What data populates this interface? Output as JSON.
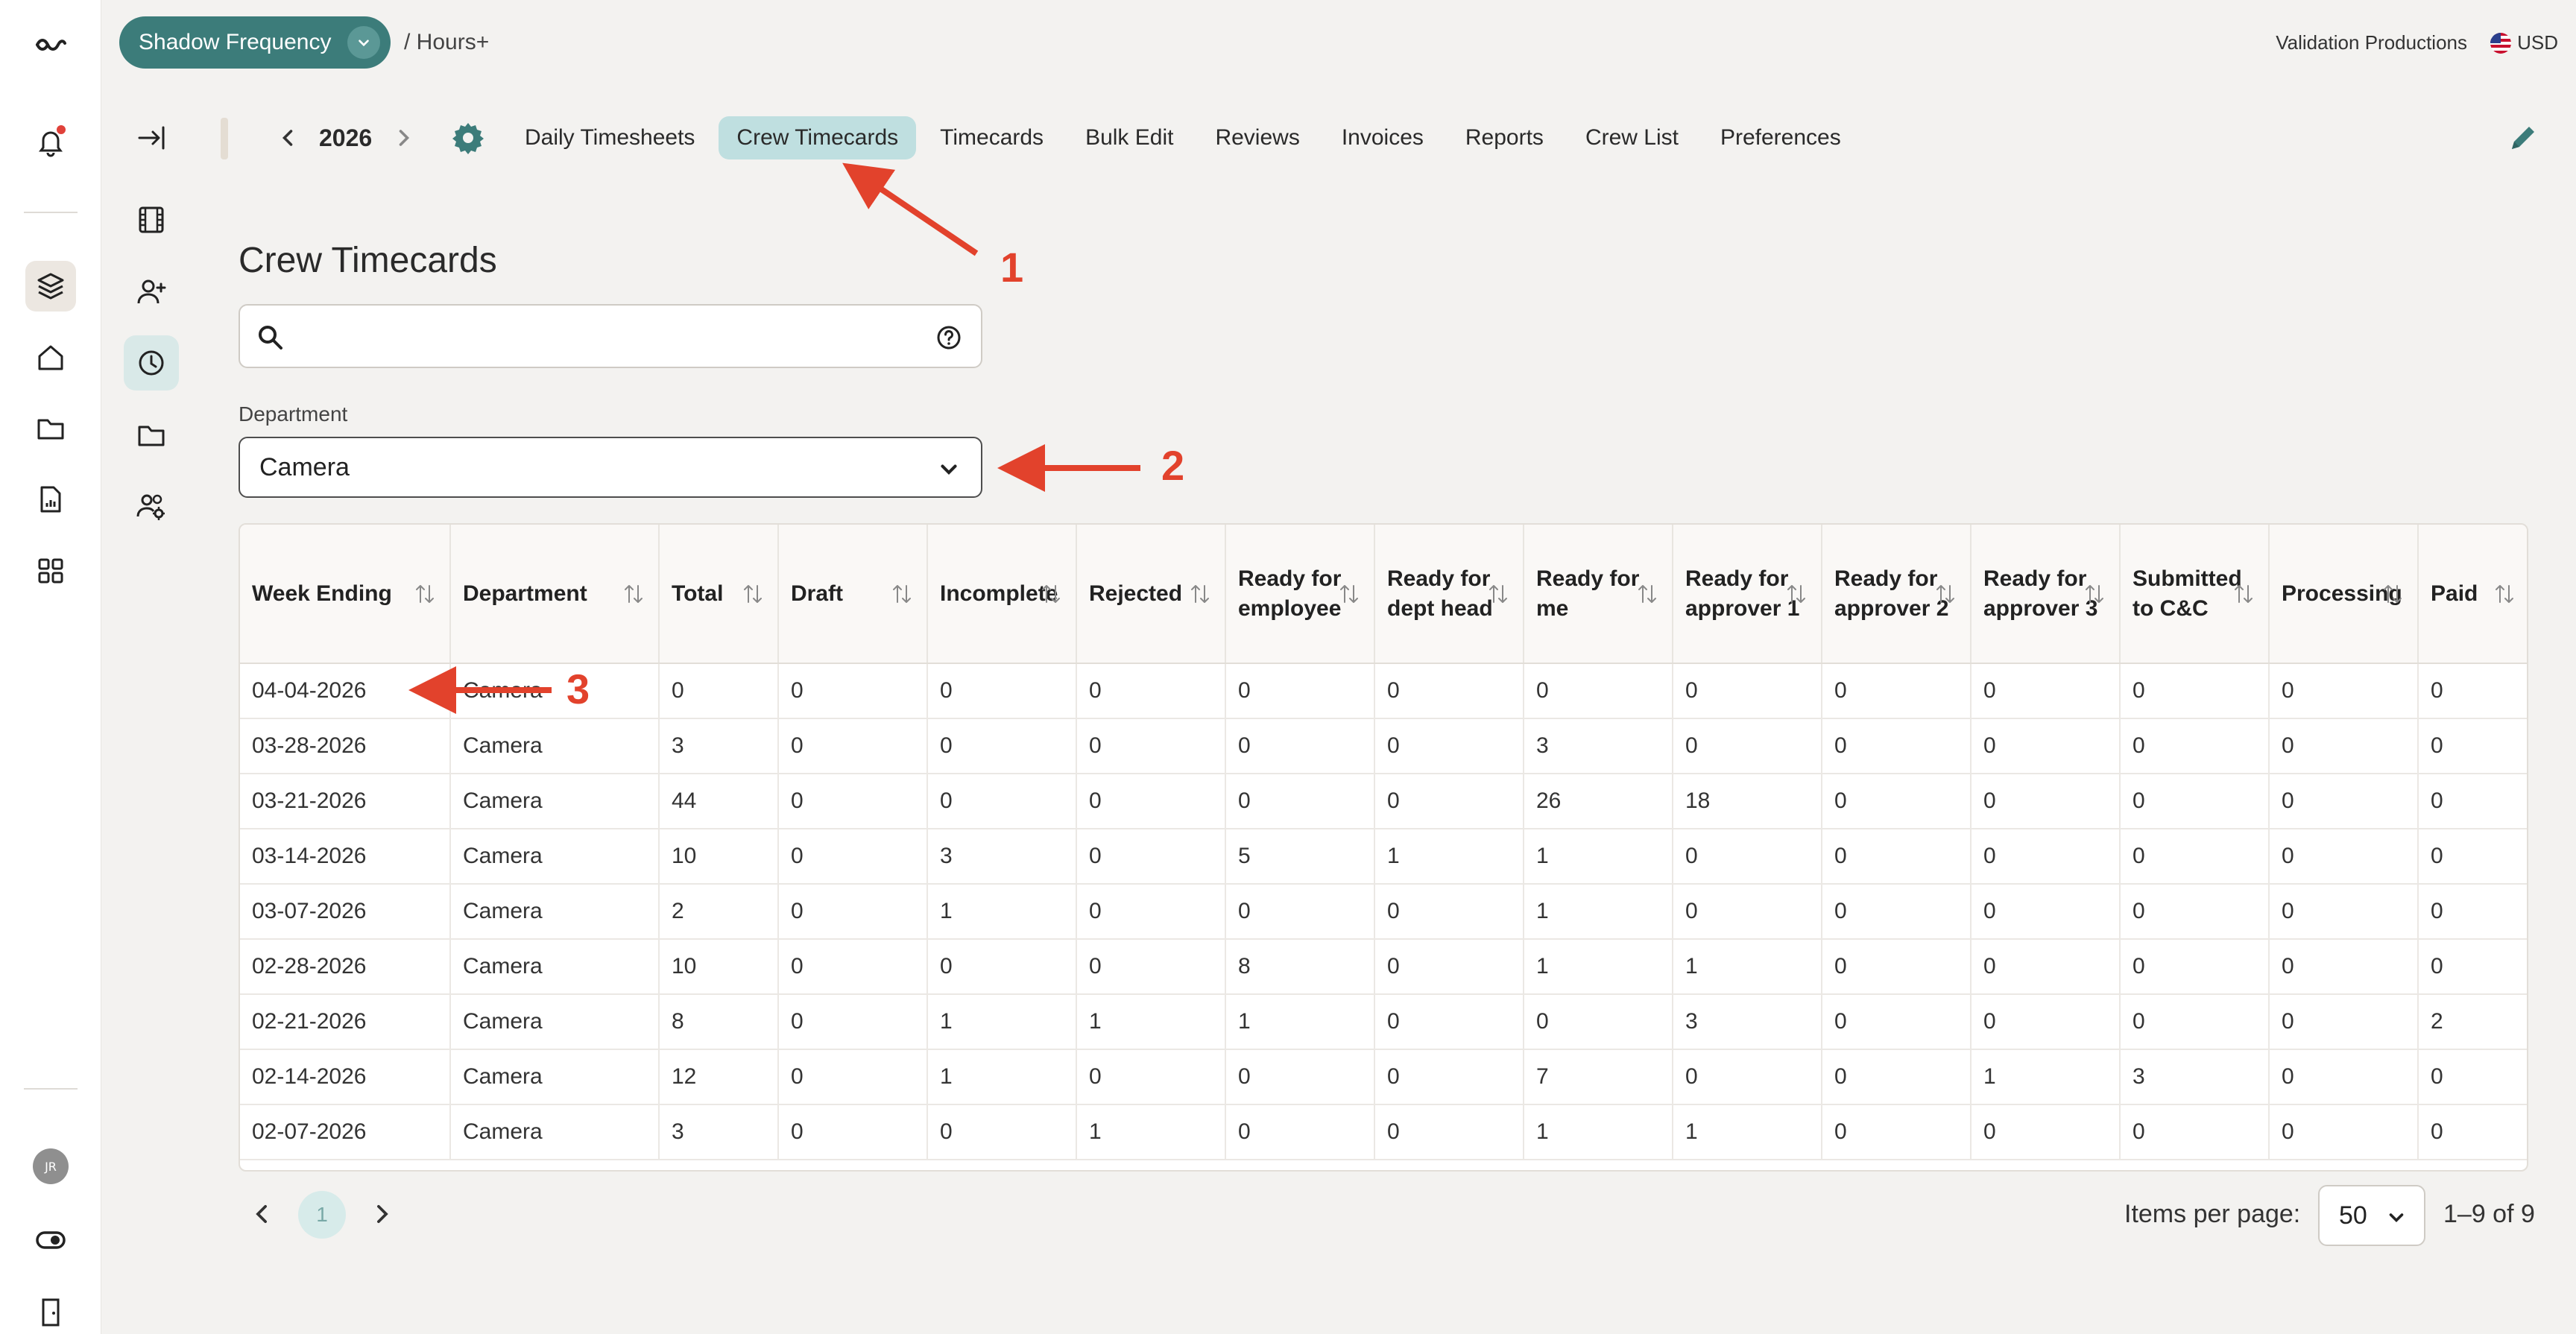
{
  "app": {
    "project_name": "Shadow Frequency",
    "breadcrumb": "/ Hours+",
    "company": "Validation Productions",
    "currency": "USD",
    "user_initials": "JR"
  },
  "nav": {
    "year": "2026",
    "tabs": [
      {
        "label": "Daily Timesheets"
      },
      {
        "label": "Crew Timecards",
        "active": true
      },
      {
        "label": "Timecards"
      },
      {
        "label": "Bulk Edit"
      },
      {
        "label": "Reviews"
      },
      {
        "label": "Invoices"
      },
      {
        "label": "Reports"
      },
      {
        "label": "Crew List"
      },
      {
        "label": "Preferences"
      }
    ]
  },
  "page": {
    "title": "Crew Timecards",
    "search": {
      "value": "",
      "placeholder": ""
    },
    "department_label": "Department",
    "department_value": "Camera"
  },
  "table": {
    "columns": [
      "Week Ending",
      "Department",
      "Total",
      "Draft",
      "Incomplete",
      "Rejected",
      "Ready for employee",
      "Ready for dept head",
      "Ready for me",
      "Ready for approver 1",
      "Ready for approver 2",
      "Ready for approver 3",
      "Submitted to C&C",
      "Processing",
      "Paid"
    ],
    "rows": [
      [
        "04-04-2026",
        "Camera",
        "0",
        "0",
        "0",
        "0",
        "0",
        "0",
        "0",
        "0",
        "0",
        "0",
        "0",
        "0",
        "0"
      ],
      [
        "03-28-2026",
        "Camera",
        "3",
        "0",
        "0",
        "0",
        "0",
        "0",
        "3",
        "0",
        "0",
        "0",
        "0",
        "0",
        "0"
      ],
      [
        "03-21-2026",
        "Camera",
        "44",
        "0",
        "0",
        "0",
        "0",
        "0",
        "26",
        "18",
        "0",
        "0",
        "0",
        "0",
        "0"
      ],
      [
        "03-14-2026",
        "Camera",
        "10",
        "0",
        "3",
        "0",
        "5",
        "1",
        "1",
        "0",
        "0",
        "0",
        "0",
        "0",
        "0"
      ],
      [
        "03-07-2026",
        "Camera",
        "2",
        "0",
        "1",
        "0",
        "0",
        "0",
        "1",
        "0",
        "0",
        "0",
        "0",
        "0",
        "0"
      ],
      [
        "02-28-2026",
        "Camera",
        "10",
        "0",
        "0",
        "0",
        "8",
        "0",
        "1",
        "1",
        "0",
        "0",
        "0",
        "0",
        "0"
      ],
      [
        "02-21-2026",
        "Camera",
        "8",
        "0",
        "1",
        "1",
        "1",
        "0",
        "0",
        "3",
        "0",
        "0",
        "0",
        "0",
        "2"
      ],
      [
        "02-14-2026",
        "Camera",
        "12",
        "0",
        "1",
        "0",
        "0",
        "0",
        "7",
        "0",
        "0",
        "1",
        "3",
        "0",
        "0"
      ],
      [
        "02-07-2026",
        "Camera",
        "3",
        "0",
        "0",
        "1",
        "0",
        "0",
        "1",
        "1",
        "0",
        "0",
        "0",
        "0",
        "0"
      ]
    ]
  },
  "pagination": {
    "current_page": "1",
    "items_per_page_label": "Items per page:",
    "items_per_page": "50",
    "range": "1–9 of 9"
  },
  "annotations": [
    {
      "number": "1",
      "target": "Crew Timecards tab"
    },
    {
      "number": "2",
      "target": "Department dropdown"
    },
    {
      "number": "3",
      "target": "Week Ending 04-04-2026"
    }
  ],
  "colors": {
    "accent_teal": "#3c7c7a",
    "active_tab": "#bfdfe0",
    "annotation_red": "#e2422c"
  }
}
